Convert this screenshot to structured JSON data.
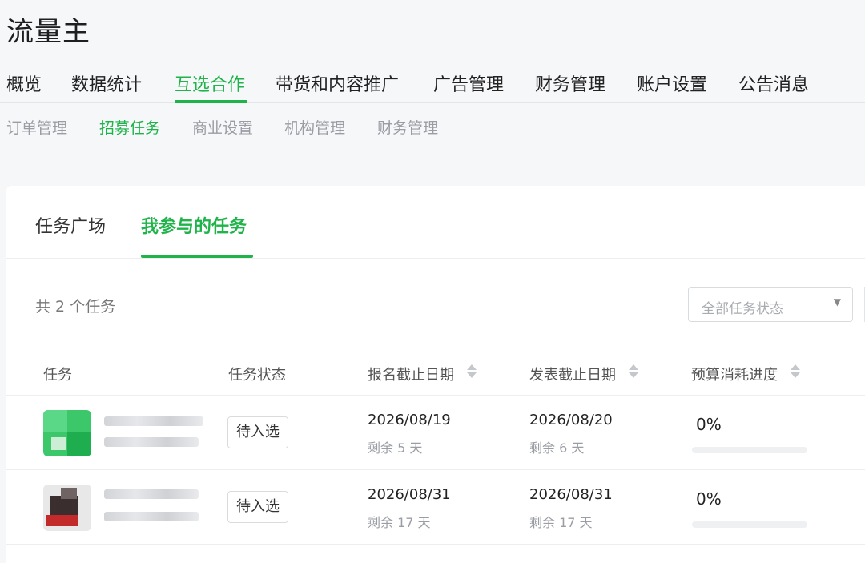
{
  "app_title": "流量主",
  "colors": {
    "accent": "#1fb34a"
  },
  "main_nav": [
    "概览",
    "数据统计",
    "互选合作",
    "带货和内容推广",
    "广告管理",
    "财务管理",
    "账户设置",
    "公告消息"
  ],
  "sub_nav": [
    "订单管理",
    "招募任务",
    "商业设置",
    "机构管理",
    "财务管理"
  ],
  "tabs": [
    "任务广场",
    "我参与的任务"
  ],
  "count_text": "共 2 个任务",
  "filter": {
    "selected": "全部任务状态",
    "icon": "chevron-down-icon"
  },
  "table": {
    "headers": [
      "任务",
      "任务状态",
      "报名截止日期",
      "发表截止日期",
      "预算消耗进度"
    ],
    "rows": [
      {
        "status": "待入选",
        "signup_deadline": "2026/08/19",
        "signup_remaining": "剩余 5 天",
        "publish_deadline": "2026/08/20",
        "publish_remaining": "剩余 6 天",
        "progress_text": "0%",
        "progress": 0
      },
      {
        "status": "待入选",
        "signup_deadline": "2026/08/31",
        "signup_remaining": "剩余 17 天",
        "publish_deadline": "2026/08/31",
        "publish_remaining": "剩余 17 天",
        "progress_text": "0%",
        "progress": 0
      }
    ]
  }
}
